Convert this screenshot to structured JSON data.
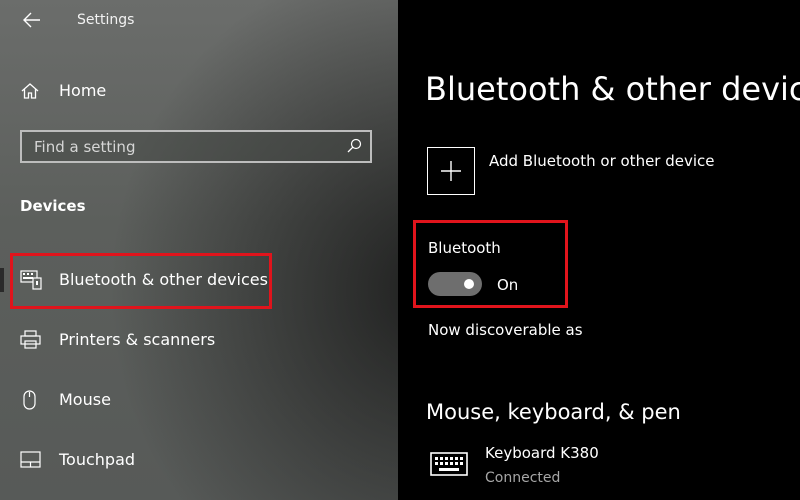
{
  "window": {
    "title": "Settings"
  },
  "sidebar": {
    "home_label": "Home",
    "search": {
      "placeholder": "Find a setting",
      "value": ""
    },
    "section_heading": "Devices",
    "items": [
      {
        "label": "Bluetooth & other devices",
        "icon": "bluetooth-devices-icon",
        "selected": true
      },
      {
        "label": "Printers & scanners",
        "icon": "printer-icon",
        "selected": false
      },
      {
        "label": "Mouse",
        "icon": "mouse-icon",
        "selected": false
      },
      {
        "label": "Touchpad",
        "icon": "touchpad-icon",
        "selected": false
      }
    ]
  },
  "main": {
    "title": "Bluetooth & other devices",
    "add_device_label": "Add Bluetooth or other device",
    "bluetooth": {
      "label": "Bluetooth",
      "state_label": "On",
      "enabled": true
    },
    "discoverable_text": "Now discoverable as",
    "peripherals_section": {
      "title": "Mouse, keyboard, & pen",
      "devices": [
        {
          "name": "Keyboard K380",
          "status": "Connected",
          "icon": "keyboard-icon"
        }
      ]
    }
  },
  "colors": {
    "highlight": "#e0141c",
    "sidebar_bg": "#5f625f",
    "content_bg": "#000000",
    "secondary_text": "#a6a6a6"
  }
}
